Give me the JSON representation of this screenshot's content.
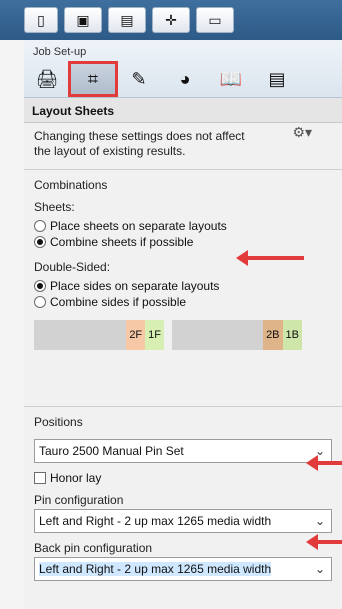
{
  "toolbar": {
    "buttons": [
      {
        "name": "pages-icon"
      },
      {
        "name": "image-icon"
      },
      {
        "name": "color-swatch-icon"
      },
      {
        "name": "crosshair-icon"
      },
      {
        "name": "panel-icon"
      }
    ]
  },
  "panel": {
    "header_title": "Job Set-up",
    "tabs": [
      {
        "name": "printer-icon"
      },
      {
        "name": "layout-icon",
        "selected": true
      },
      {
        "name": "pen-icon"
      },
      {
        "name": "color-wheel-icon"
      },
      {
        "name": "book-icon"
      },
      {
        "name": "document-icon"
      }
    ],
    "section_title": "Layout Sheets",
    "description": "Changing these settings does not affect the layout of existing results.",
    "combinations": {
      "title": "Combinations",
      "sheets_label": "Sheets:",
      "sheets_options": [
        {
          "label": "Place sheets on separate layouts",
          "selected": false
        },
        {
          "label": "Combine sheets if possible",
          "selected": true
        }
      ],
      "double_label": "Double-Sided:",
      "double_options": [
        {
          "label": "Place sides on separate layouts",
          "selected": true
        },
        {
          "label": "Combine sides if possible",
          "selected": false
        }
      ]
    },
    "chips": {
      "front": [
        "2F",
        "1F"
      ],
      "back": [
        "2B",
        "1B"
      ]
    },
    "positions": {
      "title": "Positions",
      "pin_set_value": "Tauro 2500 Manual Pin Set",
      "honor_lay_label": "Honor lay",
      "pin_config_label": "Pin configuration",
      "pin_config_value": "Left and Right - 2 up max 1265 media width",
      "back_pin_config_label": "Back pin configuration",
      "back_pin_config_value": "Left and Right - 2 up max 1265 media width"
    }
  },
  "colors": {
    "annotation_red": "#e23b3b",
    "toolbar_blue": "#2d5a87"
  }
}
